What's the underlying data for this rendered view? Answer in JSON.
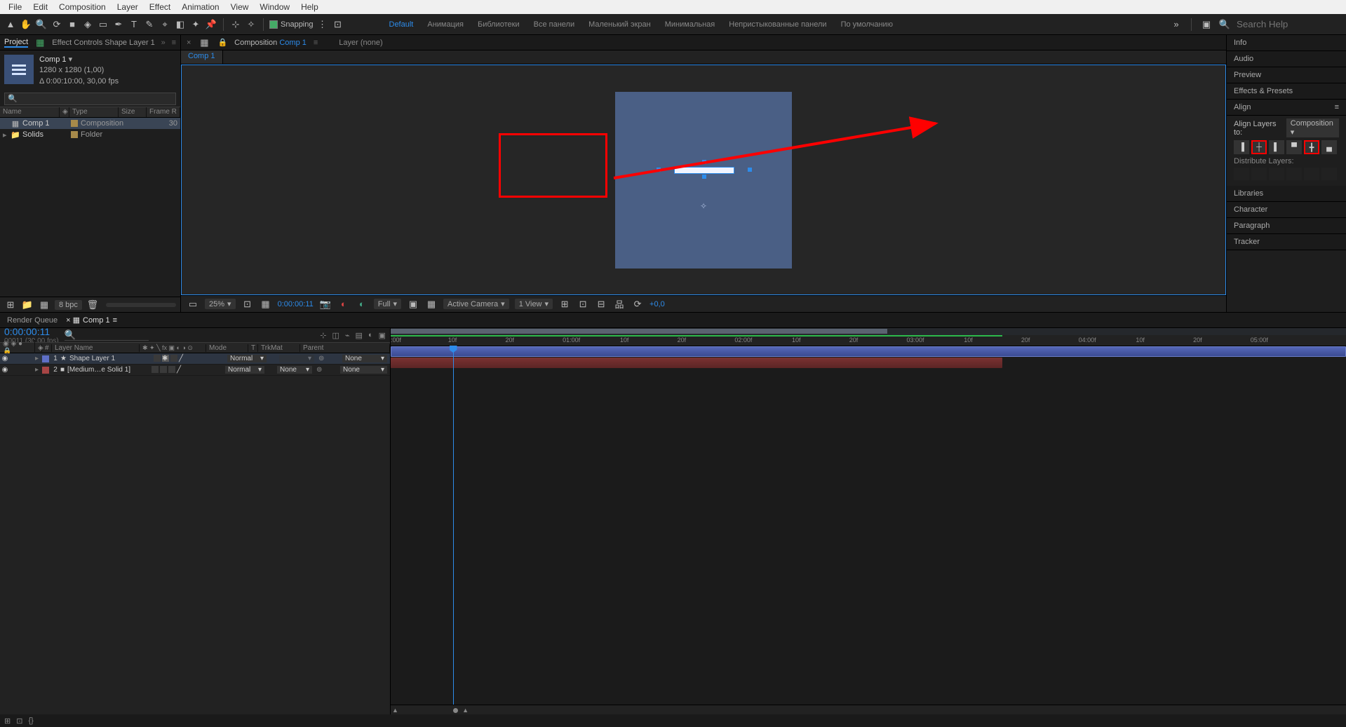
{
  "menu": [
    "File",
    "Edit",
    "Composition",
    "Layer",
    "Effect",
    "Animation",
    "View",
    "Window",
    "Help"
  ],
  "toolbar": {
    "snapping": "Snapping",
    "workspaces": [
      "Default",
      "Анимация",
      "Библиотеки",
      "Все панели",
      "Маленький экран",
      "Минимальная",
      "Непристыкованные панели",
      "По умолчанию"
    ],
    "active_ws": "Default",
    "search_ph": "Search Help"
  },
  "project": {
    "tab_project": "Project",
    "tab_effects": "Effect Controls Shape Layer 1",
    "comp_name": "Comp 1",
    "comp_caret": "▾",
    "comp_dims": "1280 x 1280 (1,00)",
    "comp_dur": "Δ 0:00:10:00, 30,00 fps",
    "headers": {
      "name": "Name",
      "type": "Type",
      "size": "Size",
      "fr": "Frame R"
    },
    "items": [
      {
        "name": "Comp 1",
        "type": "Composition",
        "fr": "30",
        "sel": true,
        "icon": "comp"
      },
      {
        "name": "Solids",
        "type": "Folder",
        "fr": "",
        "sel": false,
        "icon": "folder"
      }
    ],
    "bpc": "8 bpc"
  },
  "viewer": {
    "breadcrumb_prefix": "Composition",
    "breadcrumb_comp": "Comp 1",
    "layer_lbl": "Layer  (none)",
    "subtab": "Comp 1",
    "zoom": "25%",
    "time": "0:00:00:11",
    "res": "Full",
    "camera": "Active Camera",
    "views": "1 View",
    "exposure": "+0,0"
  },
  "right": {
    "panels": [
      "Info",
      "Audio",
      "Preview",
      "Effects & Presets"
    ],
    "align_title": "Align",
    "align_to_lbl": "Align Layers to:",
    "align_to_val": "Composition",
    "dist_lbl": "Distribute Layers:",
    "panels2": [
      "Libraries",
      "Character",
      "Paragraph",
      "Tracker"
    ]
  },
  "timeline": {
    "tab_rq": "Render Queue",
    "tab_comp": "Comp 1",
    "current_time": "0:00:00:11",
    "fps_lbl": "00011 (30.00 fps)",
    "headers": {
      "num": "#",
      "layer": "Layer Name",
      "mode": "Mode",
      "t": "T",
      "trk": "TrkMat",
      "par": "Parent"
    },
    "layers": [
      {
        "num": "1",
        "name": "Shape Layer 1",
        "swatch": "#5e6fc6",
        "mode": "Normal",
        "trk": "",
        "par": "None",
        "sel": true,
        "star": true
      },
      {
        "num": "2",
        "name": "[Medium…e Solid 1]",
        "swatch": "#a74545",
        "mode": "Normal",
        "trk": "None",
        "par": "None",
        "sel": false,
        "star": false
      }
    ],
    "ruler": [
      {
        "t": ":00f",
        "p": 0
      },
      {
        "t": "10f",
        "p": 6
      },
      {
        "t": "20f",
        "p": 12
      },
      {
        "t": "01:00f",
        "p": 18
      },
      {
        "t": "10f",
        "p": 24
      },
      {
        "t": "20f",
        "p": 30
      },
      {
        "t": "02:00f",
        "p": 36
      },
      {
        "t": "10f",
        "p": 42
      },
      {
        "t": "20f",
        "p": 48
      },
      {
        "t": "03:00f",
        "p": 54
      },
      {
        "t": "10f",
        "p": 60
      },
      {
        "t": "20f",
        "p": 66
      },
      {
        "t": "04:00f",
        "p": 72
      },
      {
        "t": "10f",
        "p": 78
      },
      {
        "t": "20f",
        "p": 84
      },
      {
        "t": "05:00f",
        "p": 90
      }
    ],
    "playhead_pct": 6.5,
    "workarea": {
      "start": 0,
      "end": 52
    }
  },
  "colors": {
    "accent": "#2d8ceb",
    "red": "#ff0000",
    "canvas": "#4a5f85"
  }
}
